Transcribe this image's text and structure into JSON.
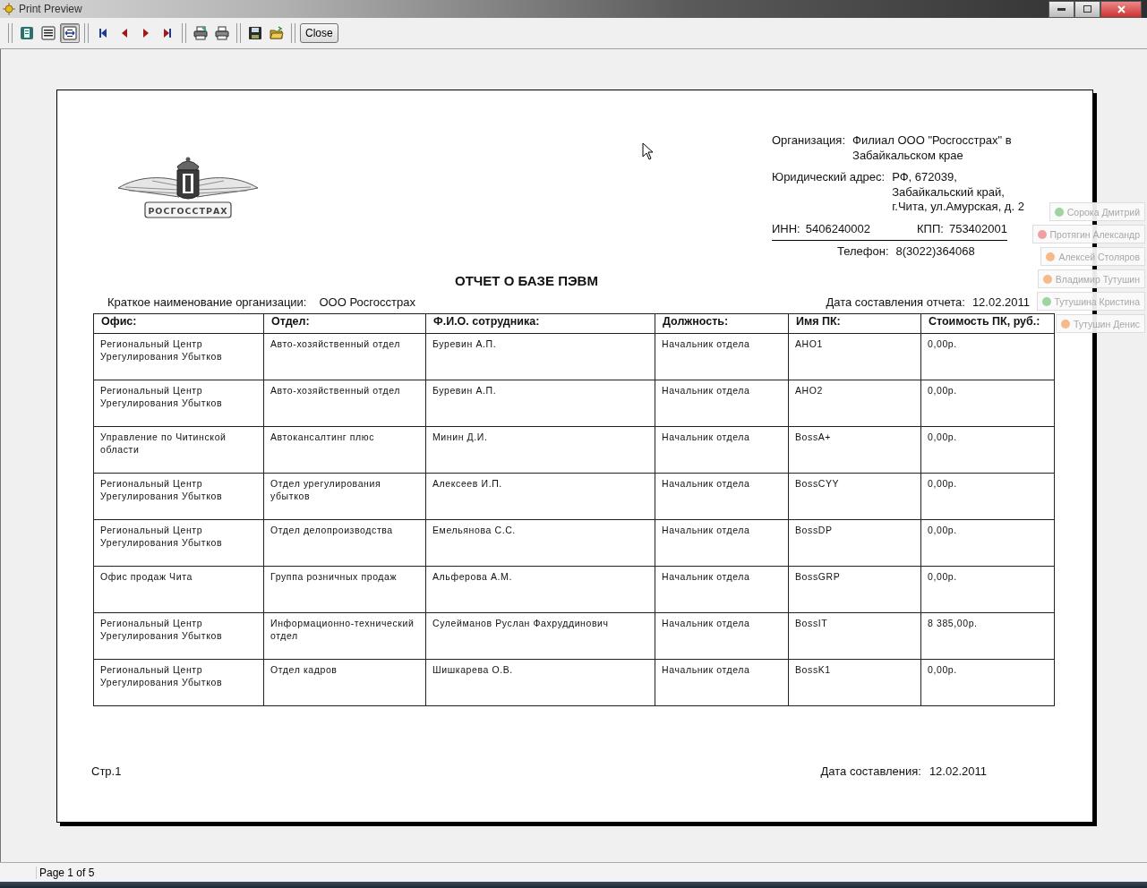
{
  "window": {
    "title": "Print Preview"
  },
  "toolbar": {
    "view_buttons": [
      {
        "kind": "page",
        "selected": false
      },
      {
        "kind": "lines",
        "selected": false
      },
      {
        "kind": "fit",
        "selected": true
      }
    ],
    "nav_buttons": [
      {
        "kind": "first"
      },
      {
        "kind": "prev"
      },
      {
        "kind": "next"
      },
      {
        "kind": "last"
      }
    ],
    "file_buttons": [
      {
        "kind": "print-setup"
      },
      {
        "kind": "print"
      },
      {
        "kind": "save"
      },
      {
        "kind": "open"
      }
    ],
    "close_button": "Close"
  },
  "report": {
    "logo_text": "РОСГОССТРАХ",
    "organization": {
      "label": "Организация:",
      "value": "Филиал ООО \"Росгосстрах\" в\nЗабайкальском крае"
    },
    "address": {
      "label": "Юридический адрес:",
      "value": "РФ, 672039,\nЗабайкальский край,\nг.Чита, ул.Амурская, д. 2"
    },
    "inn": {
      "label": "ИНН:",
      "value": "5406240002"
    },
    "kpp": {
      "label": "КПП:",
      "value": "753402001"
    },
    "phone": {
      "label": "Телефон:",
      "value": "8(3022)364068"
    },
    "title": "ОТЧЕТ О БАЗЕ ПЭВМ",
    "short_name": {
      "label": "Краткое наименование организации:",
      "value": "ООО Росгосстрах"
    },
    "report_date": {
      "label": "Дата составления отчета:",
      "value": "12.02.2011"
    },
    "table": {
      "columns": [
        "Офис:",
        "Отдел:",
        "Ф.И.О. сотрудника:",
        "Должность:",
        "Имя ПК:",
        "Стоимость ПК, руб.:"
      ],
      "rows": [
        [
          "Региональный Центр\nУрегулирования Убытков",
          "Авто-хозяйственный отдел",
          "Буревин А.П.",
          "Начальник отдела",
          "АНО1",
          "0,00р."
        ],
        [
          "Региональный Центр\nУрегулирования Убытков",
          "Авто-хозяйственный отдел",
          "Буревин А.П.",
          "Начальник отдела",
          "АНО2",
          "0,00р."
        ],
        [
          "Управление по Читинской\nобласти",
          "Автокансалтинг плюс",
          "Минин Д.И.",
          "Начальник отдела",
          "BossA+",
          "0,00р."
        ],
        [
          "Региональный Центр\nУрегулирования Убытков",
          "Отдел урегулирования\nубытков",
          "Алексеев И.П.",
          "Начальник отдела",
          "BossCYY",
          "0,00р."
        ],
        [
          "Региональный Центр\nУрегулирования Убытков",
          "Отдел делопроизводства",
          "Емельянова С.С.",
          "Начальник отдела",
          "BossDP",
          "0,00р."
        ],
        [
          "Офис продаж Чита",
          "Группа розничных продаж",
          "Альферова А.М.",
          "Начальник отдела",
          "BossGRP",
          "0,00р."
        ],
        [
          "Региональный Центр\nУрегулирования Убытков",
          "Информационно-технический\nотдел",
          "Сулейманов Руслан Фахруддинович",
          "Начальник отдела",
          "BossIT",
          "8 385,00р."
        ],
        [
          "Региональный Центр\nУрегулирования Убытков",
          "Отдел кадров",
          "Шишкарева О.В.",
          "Начальник отдела",
          "BossK1",
          "0,00р."
        ]
      ]
    },
    "footer": {
      "page": "Стр.1",
      "date": {
        "label": "Дата составления:",
        "value": "12.02.2011"
      }
    }
  },
  "notifications": [
    {
      "name": "Сорока Дмитрий",
      "color": "#9fd39f"
    },
    {
      "name": "Протягин Александр",
      "color": "#f0a0a0"
    },
    {
      "name": "Алексей Столяров",
      "color": "#f5b98a"
    },
    {
      "name": "Владимир Тутушин",
      "color": "#f5b98a"
    },
    {
      "name": "Тутушина Кристина",
      "color": "#9fd39f"
    },
    {
      "name": "Тутушин Денис",
      "color": "#f5b98a"
    }
  ],
  "status_bar": {
    "page_info": "Page 1 of 5"
  }
}
